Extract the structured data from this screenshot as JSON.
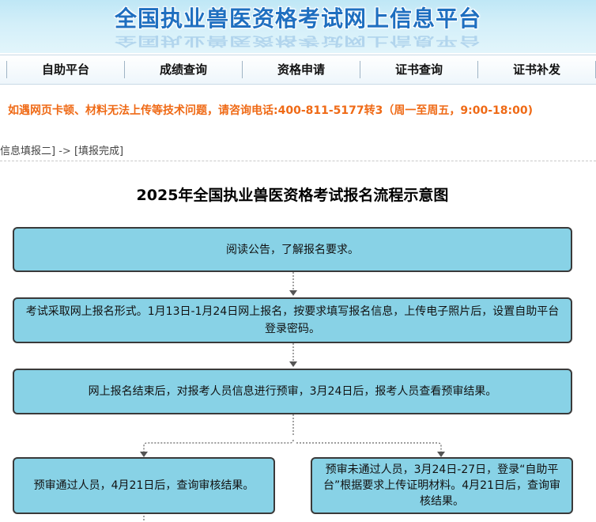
{
  "banner": {
    "title": "全国执业兽医资格考试网上信息平台"
  },
  "nav": {
    "items": [
      {
        "label": "自助平台"
      },
      {
        "label": "成绩查询"
      },
      {
        "label": "资格申请"
      },
      {
        "label": "证书查询"
      },
      {
        "label": "证书补发"
      }
    ]
  },
  "notice": {
    "text": "如遇网页卡顿、材料无法上传等技术问题，请咨询电话:400-811-5177转3（周一至周五，9:00-18:00)"
  },
  "breadcrumb": {
    "step_prev": "信息填报二]",
    "arrow": "->",
    "step_current": "[填报完成]"
  },
  "flowchart": {
    "title": "2025年全国执业兽医资格考试报名流程示意图",
    "steps": [
      {
        "text": "阅读公告，了解报名要求。"
      },
      {
        "text": "考试采取网上报名形式。1月13日-1月24日网上报名，按要求填写报名信息，上传电子照片后，设置自助平台登录密码。"
      },
      {
        "text": "网上报名结束后，对报考人员信息进行预审，3月24日后，报考人员查看预审结果。"
      },
      {
        "text": "预审通过人员，4月21日后，查询审核结果。"
      },
      {
        "text": "预审未通过人员，3月24日-27日，登录“自助平台”根据要求上传证明材料。4月21日后，查询审核结果。"
      }
    ]
  },
  "colors": {
    "box_fill": "#88d2e6",
    "notice": "#ef6a16",
    "banner_text": "#1f6fc0"
  }
}
